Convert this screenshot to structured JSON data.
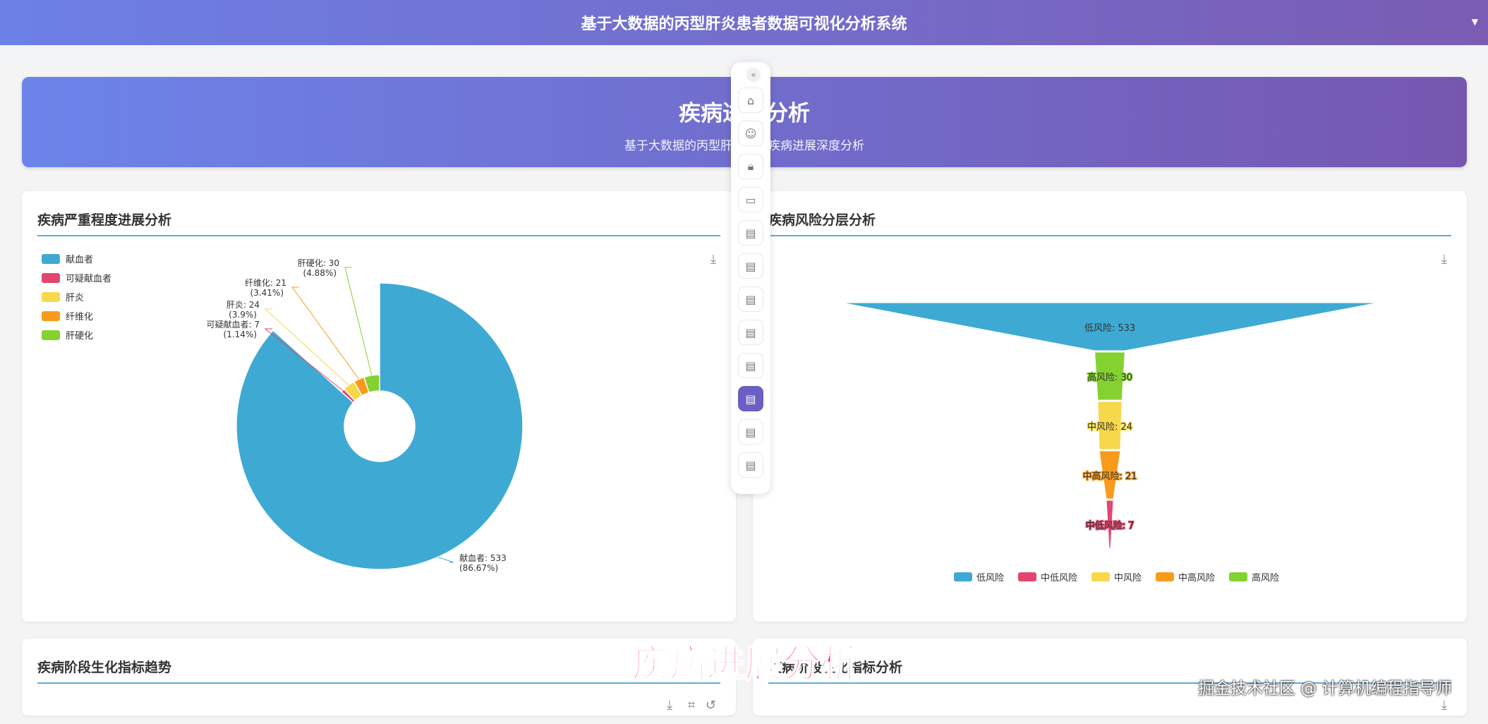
{
  "app": {
    "title": "基于大数据的丙型肝炎患者数据可视化分析系统"
  },
  "banner": {
    "title": "疾病进展分析",
    "subtitle": "基于大数据的丙型肝炎患者疾病进展深度分析"
  },
  "cards": {
    "severity": {
      "title": "疾病严重程度进展分析"
    },
    "risk": {
      "title": "疾病风险分层分析"
    },
    "trend": {
      "title": "疾病阶段生化指标趋势"
    },
    "indicator": {
      "title": "疾病阶段生化指标分析"
    }
  },
  "sidebar": {
    "collapse_icon": "double-chevron-left-icon",
    "items": [
      {
        "icon": "home-icon"
      },
      {
        "icon": "user-icon"
      },
      {
        "icon": "lock-icon"
      },
      {
        "icon": "presentation-icon"
      },
      {
        "icon": "document-icon"
      },
      {
        "icon": "document-icon"
      },
      {
        "icon": "document-icon"
      },
      {
        "icon": "document-icon"
      },
      {
        "icon": "document-icon"
      },
      {
        "icon": "document-icon",
        "active": true
      },
      {
        "icon": "document-icon"
      },
      {
        "icon": "document-icon"
      }
    ]
  },
  "overlay": {
    "caption": "疾病进展分析",
    "watermark": "掘金技术社区 @ 计算机编程指导师"
  },
  "colors": {
    "blue": "#3eaad4",
    "pink": "#e2466f",
    "yellow": "#f7d84a",
    "orange": "#f89b1c",
    "green": "#84d22f",
    "accent": "#6a5fc2"
  },
  "chart_data": [
    {
      "type": "pie",
      "legend_position": "top-left",
      "categories": [
        "献血者",
        "可疑献血者",
        "肝炎",
        "纤维化",
        "肝硬化"
      ],
      "values": [
        533,
        7,
        24,
        21,
        30
      ],
      "labels": [
        {
          "line1": "献血者: 533",
          "line2": "(86.67%)"
        },
        {
          "line1": "可疑献血者: 7",
          "line2": "(1.14%)"
        },
        {
          "line1": "肝炎: 24",
          "line2": "(3.9%)"
        },
        {
          "line1": "纤维化: 21",
          "line2": "(3.41%)"
        },
        {
          "line1": "肝硬化: 30",
          "line2": "(4.88%)"
        }
      ],
      "colors": [
        "#3eaad4",
        "#e2466f",
        "#f7d84a",
        "#f89b1c",
        "#84d22f"
      ]
    },
    {
      "type": "funnel",
      "legend_position": "bottom-center",
      "categories": [
        "低风险",
        "高风险",
        "中风险",
        "中高风险",
        "中低风险"
      ],
      "values": [
        533,
        30,
        24,
        21,
        7
      ],
      "labels": [
        "低风险: 533",
        "高风险: 30",
        "中风险: 24",
        "中高风险: 21",
        "中低风险: 7"
      ],
      "colors": [
        "#3eaad4",
        "#84d22f",
        "#f7d84a",
        "#f89b1c",
        "#e2466f"
      ],
      "legend": [
        {
          "name": "低风险",
          "color": "#3eaad4"
        },
        {
          "name": "中低风险",
          "color": "#e2466f"
        },
        {
          "name": "中风险",
          "color": "#f7d84a"
        },
        {
          "name": "中高风险",
          "color": "#f89b1c"
        },
        {
          "name": "高风险",
          "color": "#84d22f"
        }
      ]
    }
  ]
}
